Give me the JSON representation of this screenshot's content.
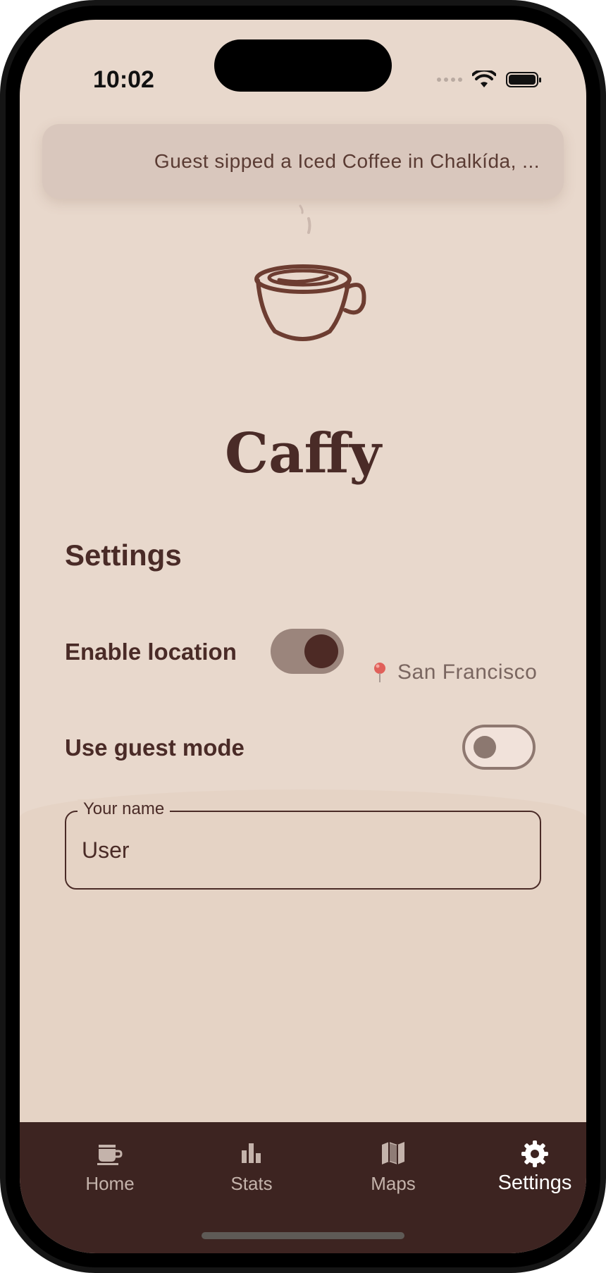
{
  "status_bar": {
    "time": "10:02"
  },
  "activity_banner": {
    "text": "Guest sipped a Iced Coffee in Chalkída, ..."
  },
  "app": {
    "title": "Caffy"
  },
  "settings": {
    "section_title": "Settings",
    "location": {
      "label": "Enable location",
      "enabled": true,
      "city": "San Francisco"
    },
    "guest_mode": {
      "label": "Use guest mode",
      "enabled": false
    },
    "name_field": {
      "label": "Your name",
      "value": "User"
    }
  },
  "tab_bar": {
    "active": "Settings",
    "items": [
      {
        "label": "Home",
        "icon": "coffee-cup-icon"
      },
      {
        "label": "Stats",
        "icon": "bar-chart-icon"
      },
      {
        "label": "Maps",
        "icon": "map-icon"
      },
      {
        "label": "Settings",
        "icon": "gear-icon"
      }
    ]
  },
  "colors": {
    "background": "#e8d8cc",
    "primary_brown": "#4a2b27",
    "tab_bar": "#3d2421",
    "toggle_on_track": "#9b857c"
  }
}
